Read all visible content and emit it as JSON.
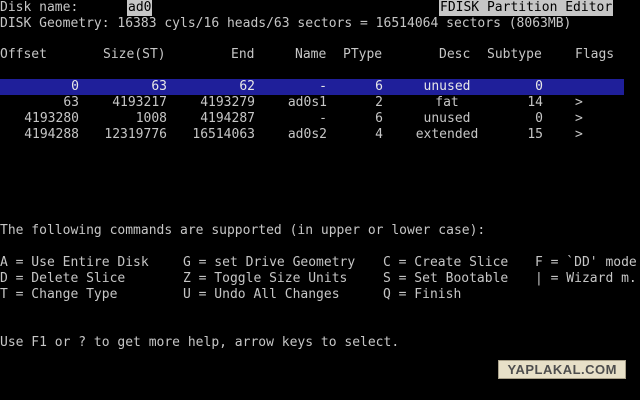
{
  "header": {
    "disk_name_label": "Disk name:",
    "disk_name_value": "ad0",
    "app_title": "FDISK Partition Editor",
    "geometry": "DISK Geometry: 16383 cyls/16 heads/63 sectors = 16514064 sectors (8063MB)"
  },
  "table": {
    "columns": [
      "Offset",
      "Size(ST)",
      "End",
      "Name",
      "PType",
      "Desc",
      "Subtype",
      "Flags"
    ],
    "rows": [
      {
        "offset": "0",
        "size": "63",
        "end": "62",
        "name": "-",
        "ptype": "6",
        "desc": "unused",
        "subtype": "0",
        "flags": ""
      },
      {
        "offset": "63",
        "size": "4193217",
        "end": "4193279",
        "name": "ad0s1",
        "ptype": "2",
        "desc": "fat",
        "subtype": "14",
        "flags": ">"
      },
      {
        "offset": "4193280",
        "size": "1008",
        "end": "4194287",
        "name": "-",
        "ptype": "6",
        "desc": "unused",
        "subtype": "0",
        "flags": ">"
      },
      {
        "offset": "4194288",
        "size": "12319776",
        "end": "16514063",
        "name": "ad0s2",
        "ptype": "4",
        "desc": "extended",
        "subtype": "15",
        "flags": ">"
      }
    ],
    "selected_row": 0
  },
  "commands": {
    "intro": "The following commands are supported (in upper or lower case):",
    "col1": [
      "A = Use Entire Disk",
      "D = Delete Slice",
      "T = Change Type"
    ],
    "col2": [
      "G = set Drive Geometry",
      "Z = Toggle Size Units",
      "U = Undo All Changes"
    ],
    "col3": [
      "C = Create Slice",
      "S = Set Bootable",
      "Q = Finish"
    ],
    "col4": [
      "F = `DD' mode",
      "| = Wizard m.",
      ""
    ]
  },
  "help": "Use F1 or ? to get more help, arrow keys to select.",
  "watermark": "YAPLAKAL.COM",
  "colors": {
    "background": "#000000",
    "text": "#c6c6c6",
    "selection_bar": "#1f1f9a"
  }
}
